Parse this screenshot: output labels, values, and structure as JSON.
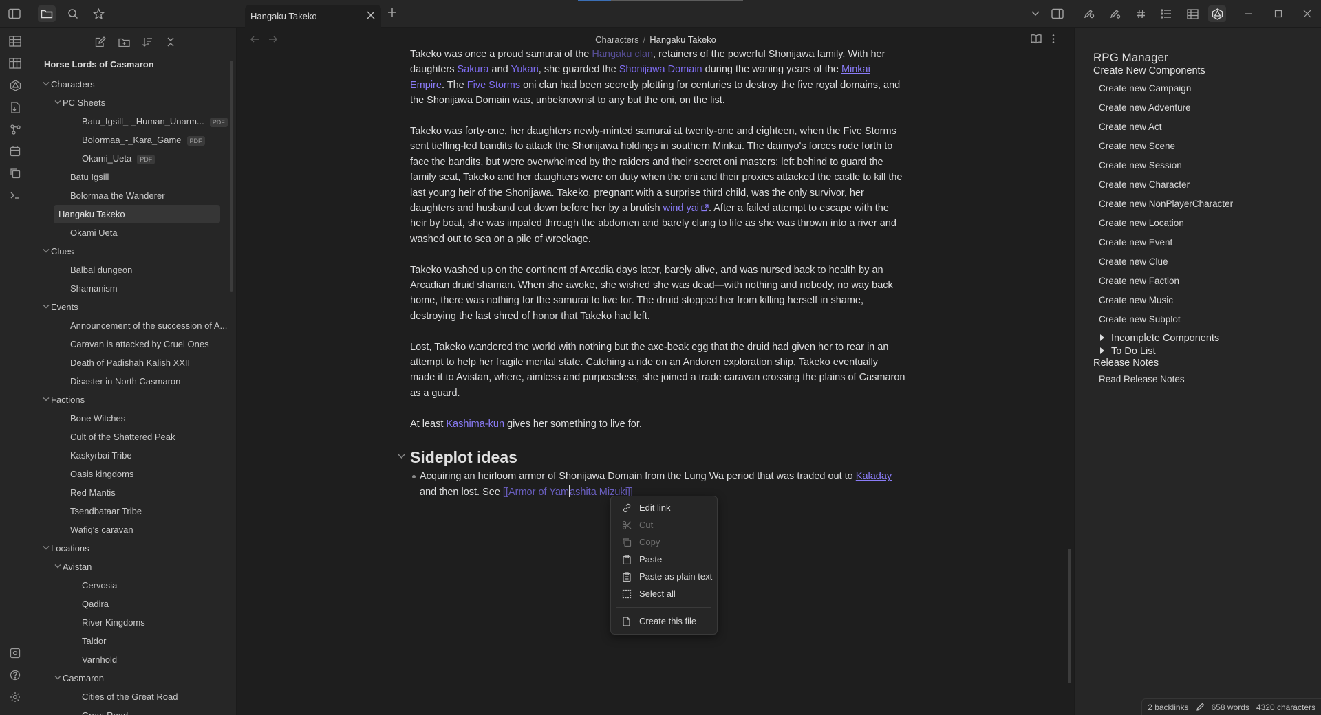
{
  "window": {
    "tab_title": "Hangaku Takeko",
    "download_progress": 0.2
  },
  "ribbon": {
    "icons": [
      "sidebar-toggle-icon",
      "table-icon",
      "table-alt-icon",
      "rpg-manager-icon",
      "import-pdf-icon",
      "graph-view-icon",
      "calendar-icon",
      "copy-icon",
      "terminal-icon",
      "vault-switch-icon",
      "help-icon",
      "settings-icon"
    ]
  },
  "file_explorer": {
    "vault_name": "Horse Lords of Casmaron",
    "tree": [
      {
        "label": "Characters",
        "level": 0,
        "folder": true
      },
      {
        "label": "PC Sheets",
        "level": 1,
        "folder": true
      },
      {
        "label": "Batu_Igsill_-_Human_Unarm...",
        "level": 2,
        "badge": "PDF"
      },
      {
        "label": "Bolormaa_-_Kara_Game",
        "level": 2,
        "badge": "PDF"
      },
      {
        "label": "Okami_Ueta",
        "level": 2,
        "badge": "PDF"
      },
      {
        "label": "Batu Igsill",
        "level": 1
      },
      {
        "label": "Bolormaa the Wanderer",
        "level": 1
      },
      {
        "label": "Hangaku Takeko",
        "level": 1,
        "active": true
      },
      {
        "label": "Okami Ueta",
        "level": 1
      },
      {
        "label": "Clues",
        "level": 0,
        "folder": true
      },
      {
        "label": "Balbal dungeon",
        "level": 1
      },
      {
        "label": "Shamanism",
        "level": 1
      },
      {
        "label": "Events",
        "level": 0,
        "folder": true
      },
      {
        "label": "Announcement of the succession of A...",
        "level": 1
      },
      {
        "label": "Caravan is attacked by Cruel Ones",
        "level": 1
      },
      {
        "label": "Death of Padishah Kalish XXII",
        "level": 1
      },
      {
        "label": "Disaster in North Casmaron",
        "level": 1
      },
      {
        "label": "Factions",
        "level": 0,
        "folder": true
      },
      {
        "label": "Bone Witches",
        "level": 1
      },
      {
        "label": "Cult of the Shattered Peak",
        "level": 1
      },
      {
        "label": "Kaskyrbai Tribe",
        "level": 1
      },
      {
        "label": "Oasis kingdoms",
        "level": 1
      },
      {
        "label": "Red Mantis",
        "level": 1
      },
      {
        "label": "Tsendbataar Tribe",
        "level": 1
      },
      {
        "label": "Wafiq's caravan",
        "level": 1
      },
      {
        "label": "Locations",
        "level": 0,
        "folder": true
      },
      {
        "label": "Avistan",
        "level": 1,
        "folder": true
      },
      {
        "label": "Cervosia",
        "level": 2
      },
      {
        "label": "Qadira",
        "level": 2
      },
      {
        "label": "River Kingdoms",
        "level": 2
      },
      {
        "label": "Taldor",
        "level": 2
      },
      {
        "label": "Varnhold",
        "level": 2
      },
      {
        "label": "Casmaron",
        "level": 1,
        "folder": true
      },
      {
        "label": "Cities of the Great Road",
        "level": 2
      },
      {
        "label": "Great Road",
        "level": 2
      }
    ]
  },
  "editor": {
    "breadcrumb_parent": "Characters",
    "breadcrumb_sep": "/",
    "breadcrumb_current": "Hangaku Takeko",
    "p0": {
      "a": "Takeko was once a proud samurai of the ",
      "link1": "Hangaku clan",
      "b": ", retainers of the powerful Shonijawa family.  With her daughters ",
      "link2": "Sakura",
      "c": " and ",
      "link3": "Yukari",
      "d": ", she guarded the ",
      "link4": "Shonijawa Domain",
      "e": " during the waning years of the ",
      "link5": "Minkai Empire",
      "f": ".   The ",
      "link6": "Five Storms",
      "g": " oni clan had been secretly plotting for centuries to destroy the five royal domains, and the Shonijawa Domain was, unbeknownst to any but the oni, on the list."
    },
    "p1": {
      "a": "Takeko was forty-one, her daughters newly-minted samurai at twenty-one and eighteen, when the Five Storms sent tiefling-led bandits to attack the Shonijawa holdings in southern Minkai.  The daimyo's forces rode forth to face the bandits, but were overwhelmed by the raiders and their secret oni masters; left behind to guard the family seat, Takeko and her daughters were on duty when the oni and their proxies attacked the castle to kill the last young heir of the Shonijawa.  Takeko, pregnant with a surprise third child, was the only survivor, her daughters and husband cut down before her by a brutish ",
      "link": "wind yai",
      "b": ".  After a failed attempt to escape with the heir by boat, she was impaled through the abdomen and barely clung to life as she was thrown into a river and washed out to sea on a pile of wreckage."
    },
    "p2": "Takeko washed up on the continent of Arcadia days later, barely alive, and was nursed back to health by an Arcadian druid shaman.  When she awoke, she wished she was dead—with nothing and nobody, no way back home, there was nothing for the samurai to live for.  The druid stopped her from killing herself in shame, destroying the last shred of honor that Takeko had left.",
    "p3": "Lost, Takeko wandered the world with nothing but the axe-beak egg that the druid had given her to rear in an attempt to help her fragile mental state.  Catching a ride on an Andoren exploration ship, Takeko eventually made it to Avistan, where, aimless and purposeless, she joined a trade caravan crossing the plains of Casmaron as a guard.",
    "p4": {
      "a": "At least ",
      "link": "Kashima-kun",
      "b": " gives her something to live for."
    },
    "heading": "Sideplot ideas",
    "bullet": {
      "a": "Acquiring an heirloom armor of Shonijawa Domain from the Lung Wa period that was traded out to ",
      "link": "Kaladay",
      "b": " and then lost. See ",
      "wiki_before_caret": "[[Armor of Yam",
      "wiki_after_caret": "ashita Mizuki]]"
    }
  },
  "context_menu": {
    "edit_link": "Edit link",
    "cut": "Cut",
    "copy": "Copy",
    "paste": "Paste",
    "paste_plain": "Paste as plain text",
    "select_all": "Select all",
    "create_file": "Create this file"
  },
  "rpg_manager": {
    "title": "RPG Manager",
    "create_section": "Create New Components",
    "create_items": [
      "Create new Campaign",
      "Create new Adventure",
      "Create new Act",
      "Create new Scene",
      "Create new Session",
      "Create new Character",
      "Create new NonPlayerCharacter",
      "Create new Location",
      "Create new Event",
      "Create new Clue",
      "Create new Faction",
      "Create new Music",
      "Create new Subplot"
    ],
    "incomplete": "Incomplete Components",
    "todo": "To Do List",
    "release_section": "Release Notes",
    "release_item": "Read Release Notes"
  },
  "status_bar": {
    "backlinks": "2 backlinks",
    "words": "658 words",
    "characters": "4320 characters"
  }
}
